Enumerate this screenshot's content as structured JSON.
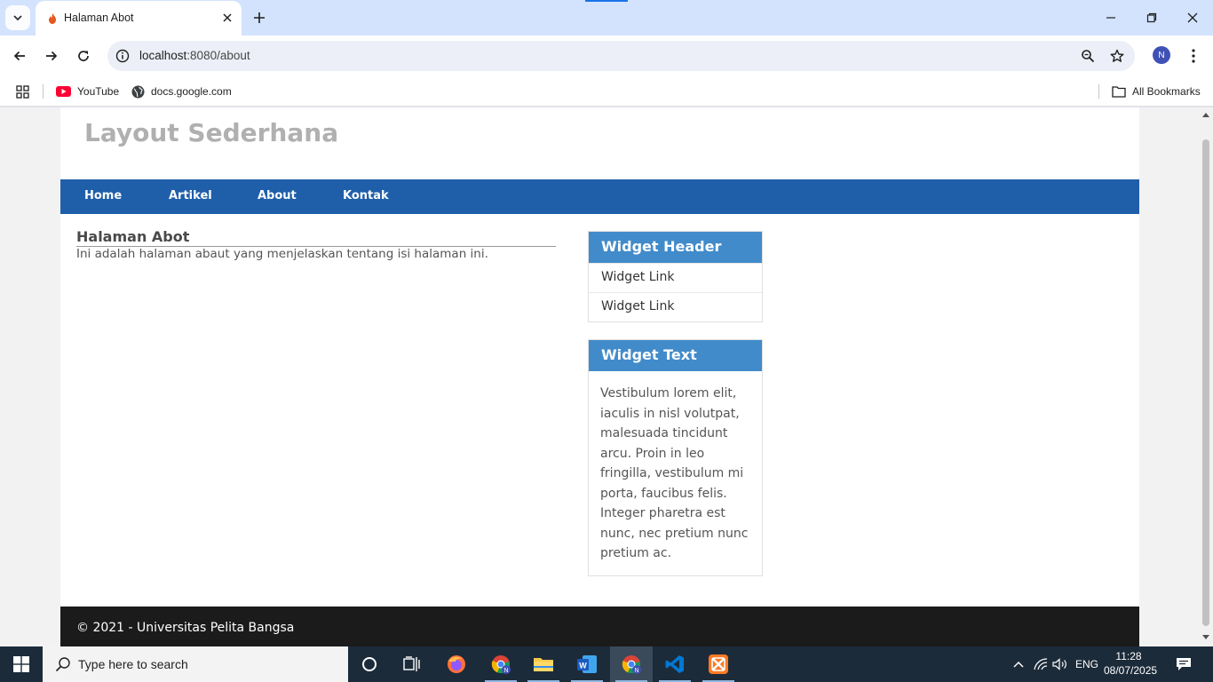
{
  "browser": {
    "tab_title": "Halaman Abot",
    "url_host": "localhost",
    "url_path": ":8080/about",
    "profile_initial": "N",
    "bookmarks": [
      {
        "label": "YouTube",
        "icon": "youtube-icon"
      },
      {
        "label": "docs.google.com",
        "icon": "globe-icon"
      }
    ],
    "all_bookmarks_label": "All Bookmarks"
  },
  "site": {
    "title": "Layout Sederhana",
    "nav": [
      "Home",
      "Artikel",
      "About",
      "Kontak"
    ],
    "page_heading": "Halaman Abot",
    "page_text": "Ini adalah halaman abaut yang menjelaskan tentang isi halaman ini.",
    "widget1": {
      "header": "Widget Header",
      "links": [
        "Widget Link",
        "Widget Link"
      ]
    },
    "widget2": {
      "header": "Widget Text",
      "body": "Vestibulum lorem elit, iaculis in nisl volutpat, malesuada tincidunt arcu. Proin in leo fringilla, vestibulum mi porta, faucibus felis. Integer pharetra est nunc, nec pretium nunc pretium ac."
    },
    "footer": "© 2021 - Universitas Pelita Bangsa"
  },
  "taskbar": {
    "search_placeholder": "Type here to search",
    "language": "ENG",
    "time": "11:28",
    "date": "08/07/2025"
  },
  "colors": {
    "nav_bg": "#1f5faa",
    "widget_header_bg": "#428bca",
    "footer_bg": "#1b1b1b"
  }
}
